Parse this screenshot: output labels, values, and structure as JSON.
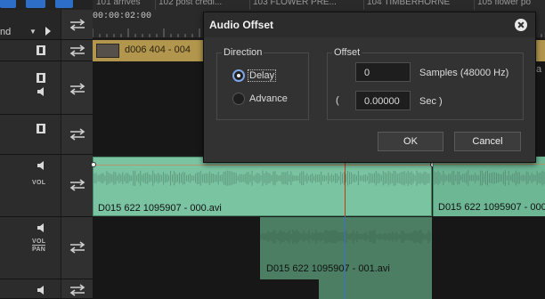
{
  "timeline": {
    "timecode": "00:00:02:00",
    "track_mode": "nd",
    "clip_names": [
      "101 arrives",
      "102 post credi...",
      "103 FLOWER PRE...",
      "104 TIMBERHORNE",
      "105 flower po"
    ],
    "video_clip_label": "d006 404 - 004",
    "right_peek_label": "a",
    "audio_clips": [
      {
        "label": "D015 622 1095907 - 000.avi"
      },
      {
        "label": "D015 622 1095907 - 000.avi"
      },
      {
        "label": "D015 622 1095907 - 001.avi"
      }
    ],
    "track_labels": {
      "vol": "VOL",
      "vol2": "VOL",
      "pan": "PAN"
    }
  },
  "dialog": {
    "title": "Audio Offset",
    "direction": {
      "label": "Direction",
      "options": [
        "Delay",
        "Advance"
      ],
      "selected": "Delay"
    },
    "offset": {
      "label": "Offset",
      "samples_value": "0",
      "samples_unit": "Samples (48000 Hz)",
      "paren_open": "(",
      "sec_value": "0.00000",
      "sec_unit": "Sec )"
    },
    "buttons": {
      "ok": "OK",
      "cancel": "Cancel"
    }
  },
  "colors": {
    "accent_blue": "#2d6ec9",
    "video_clip": "#b2964e",
    "audio_clip": "#7bc4a2",
    "playhead_red": "#c03822",
    "playhead_blue": "#3a6fd0"
  }
}
